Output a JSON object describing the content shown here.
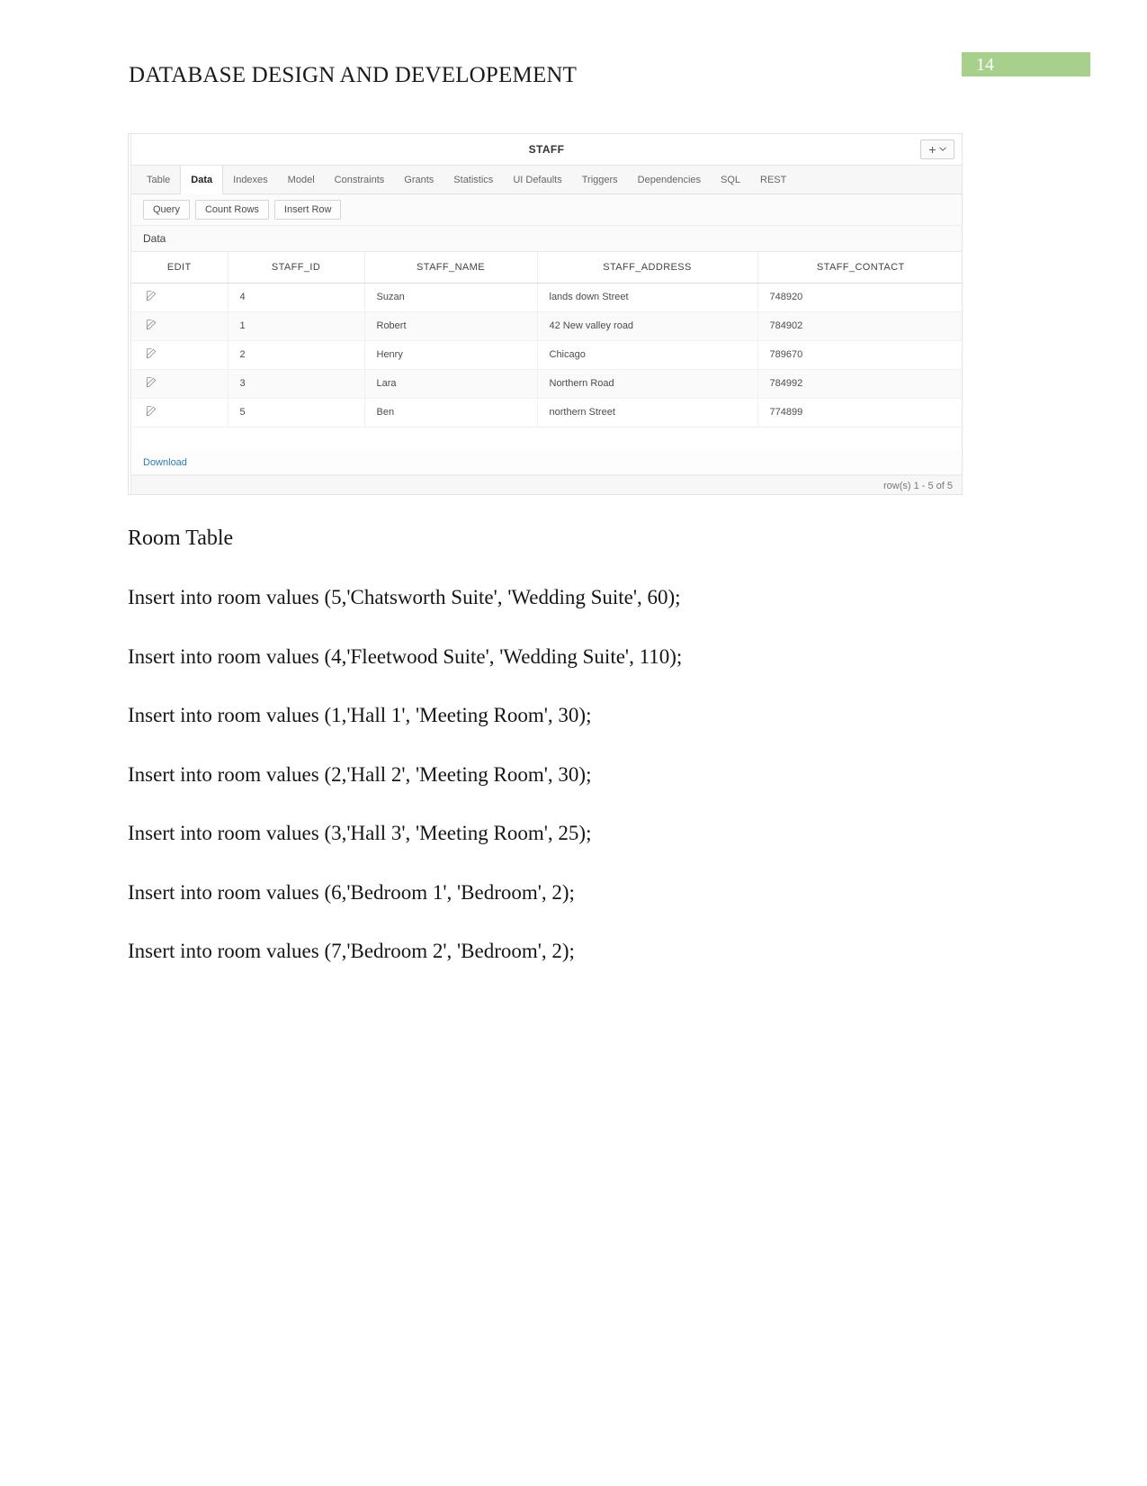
{
  "document": {
    "header_title": "DATABASE DESIGN AND DEVELOPEMENT",
    "page_number": "14",
    "header_accent_color": "#a8d08d"
  },
  "apex_screenshot": {
    "title": "STAFF",
    "add_button": {
      "plus": "+",
      "caret": "⌄"
    },
    "tabs": [
      {
        "label": "Table",
        "active": false
      },
      {
        "label": "Data",
        "active": true
      },
      {
        "label": "Indexes",
        "active": false
      },
      {
        "label": "Model",
        "active": false
      },
      {
        "label": "Constraints",
        "active": false
      },
      {
        "label": "Grants",
        "active": false
      },
      {
        "label": "Statistics",
        "active": false
      },
      {
        "label": "UI Defaults",
        "active": false
      },
      {
        "label": "Triggers",
        "active": false
      },
      {
        "label": "Dependencies",
        "active": false
      },
      {
        "label": "SQL",
        "active": false
      },
      {
        "label": "REST",
        "active": false
      }
    ],
    "toolbar_buttons": [
      "Query",
      "Count Rows",
      "Insert Row"
    ],
    "section_label": "Data",
    "columns": [
      "EDIT",
      "STAFF_ID",
      "STAFF_NAME",
      "STAFF_ADDRESS",
      "STAFF_CONTACT"
    ],
    "rows": [
      {
        "staff_id": "4",
        "staff_name": "Suzan",
        "staff_address": "lands down Street",
        "staff_contact": "748920"
      },
      {
        "staff_id": "1",
        "staff_name": "Robert",
        "staff_address": "42 New valley road",
        "staff_contact": "784902"
      },
      {
        "staff_id": "2",
        "staff_name": "Henry",
        "staff_address": "Chicago",
        "staff_contact": "789670"
      },
      {
        "staff_id": "3",
        "staff_name": "Lara",
        "staff_address": "Northern Road",
        "staff_contact": "784992"
      },
      {
        "staff_id": "5",
        "staff_name": "Ben",
        "staff_address": "northern Street",
        "staff_contact": "774899"
      }
    ],
    "download_link": "Download",
    "row_count": "row(s) 1 - 5 of 5",
    "link_color": "#337ab7"
  },
  "content": {
    "heading": "Room Table",
    "statements": [
      "Insert into room values (5,'Chatsworth Suite', 'Wedding Suite', 60);",
      "Insert into room values (4,'Fleetwood Suite', 'Wedding Suite', 110);",
      "Insert into room values (1,'Hall 1', 'Meeting Room', 30);",
      "Insert into room values (2,'Hall 2', 'Meeting Room', 30);",
      "Insert into room values (3,'Hall 3', 'Meeting Room', 25);",
      "Insert into room values (6,'Bedroom 1', 'Bedroom', 2);",
      "Insert into room values (7,'Bedroom 2', 'Bedroom', 2);"
    ]
  }
}
